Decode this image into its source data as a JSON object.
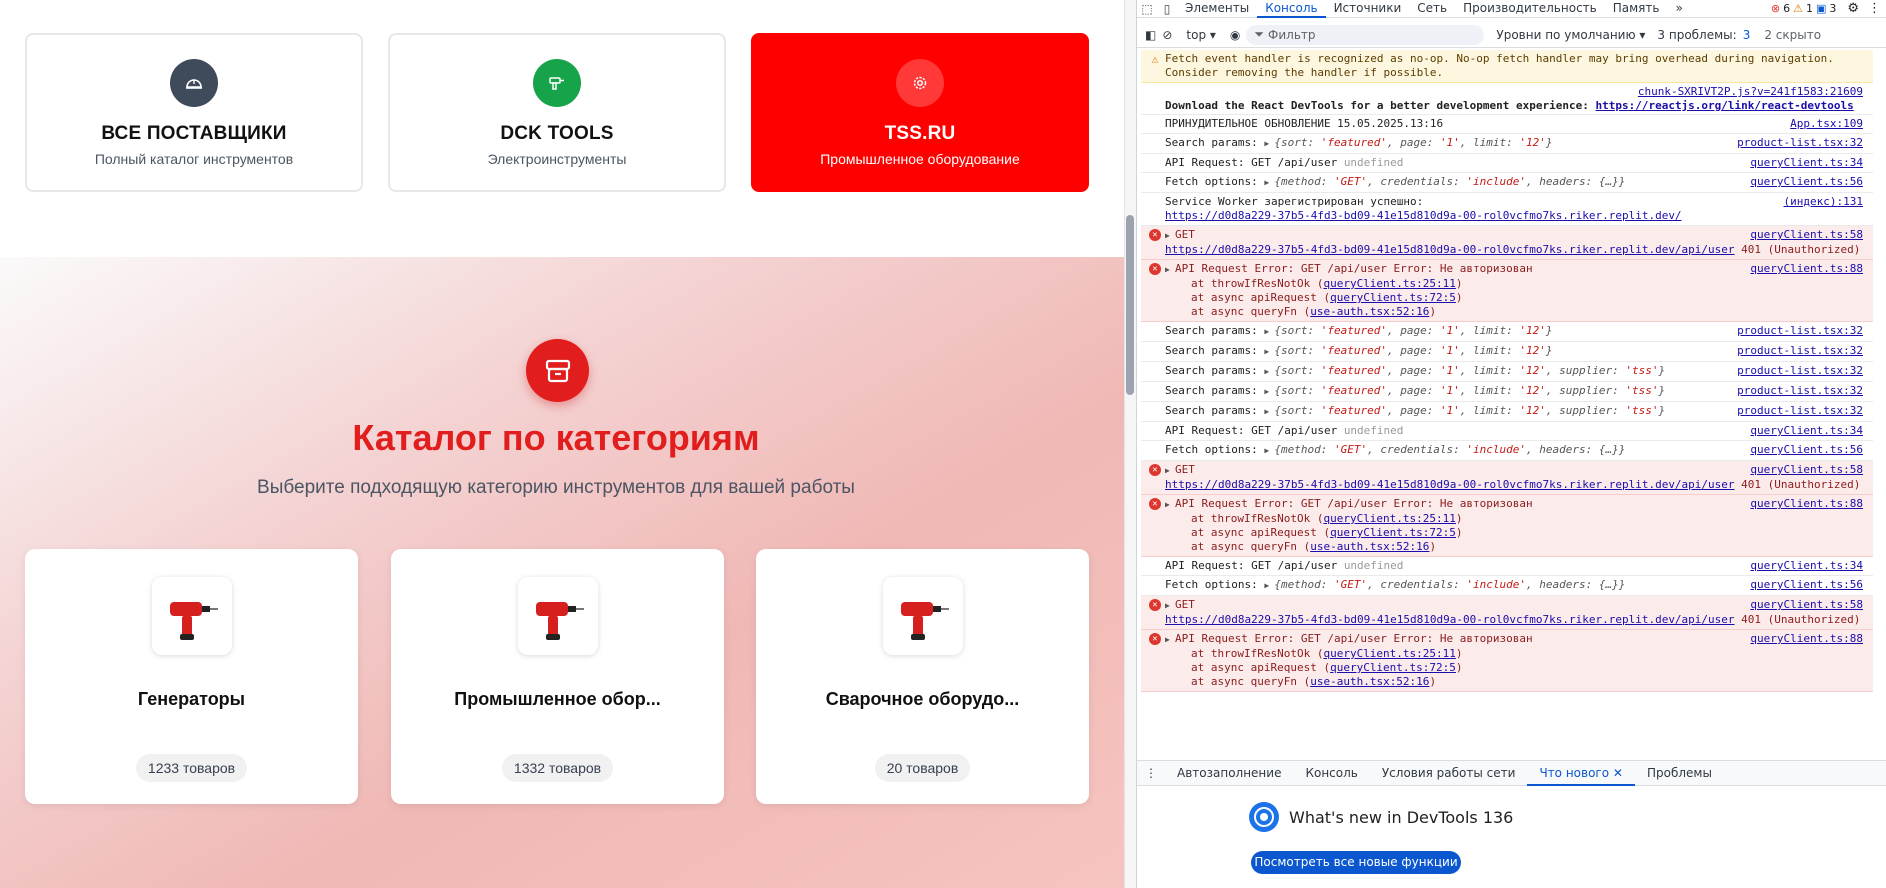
{
  "suppliers": [
    {
      "name": "ВСЕ ПОСТАВЩИКИ",
      "desc": "Полный каталог инструментов",
      "icon": "helmet-icon",
      "color": "#3f4a5a"
    },
    {
      "name": "DCK TOOLS",
      "desc": "Электроинструменты",
      "icon": "drill-icon",
      "color": "#16a34a"
    },
    {
      "name": "TSS.RU",
      "desc": "Промышленное оборудование",
      "icon": "gear-icon",
      "color": "#ff0000"
    }
  ],
  "catalog": {
    "title": "Каталог по категориям",
    "subtitle": "Выберите подходящую категорию инструментов для вашей работы",
    "icon": "box-icon",
    "categories": [
      {
        "name": "Генераторы",
        "count": "1233 товаров",
        "image": "drill-image"
      },
      {
        "name": "Промышленное обор...",
        "count": "1332 товаров",
        "image": "drill-image"
      },
      {
        "name": "Сварочное оборудо...",
        "count": "20 товаров",
        "image": "drill-image"
      }
    ]
  },
  "devtools": {
    "tabs": [
      "Элементы",
      "Консоль",
      "Источники",
      "Сеть",
      "Производительность",
      "Память"
    ],
    "more": "»",
    "badges": {
      "errors": "6",
      "warnings": "1",
      "info": "3"
    },
    "toolbar": {
      "context": "top ▾",
      "filter_placeholder": "Фильтр",
      "levels": "Уровни по умолчанию ▾",
      "issues": "3 проблемы:",
      "issues_count": "3",
      "hidden": "2 скрыто"
    },
    "console": {
      "warning_line1": "Fetch event handler is recognized as no-op. No-op fetch handler may bring overhead during navigation.",
      "warning_line2": "Consider removing the handler if possible.",
      "chunk_src": "chunk-SXRIVT2P.js?v=241f1583:21609",
      "react_msg": "Download the React DevTools for a better development experience: ",
      "react_link": "https://reactjs.org/link/react-devtools",
      "forced_update": "ПРИНУДИТЕЛЬНОЕ ОБНОВЛЕНИЕ 15.05.2025.13:16",
      "app_src": "App.tsx:109",
      "search_label": "Search params:",
      "product_src": "product-list.tsx:32",
      "api_label": "API Request: GET /api/user ",
      "undefined": "undefined",
      "query34": "queryClient.ts:34",
      "fetch_label": "Fetch options:",
      "query56": "queryClient.ts:56",
      "sw_msg": "Service Worker зарегистрирован успешно:",
      "sw_src": "(индекс):131",
      "sw_url": "https://d0d8a229-37b5-4fd3-bd09-41e15d810d9a-00-rol0vcfmo7ks.riker.replit.dev/",
      "get_label": "GET",
      "get_url": "https://d0d8a229-37b5-4fd3-bd09-41e15d810d9a-00-rol0vcfmo7ks.riker.replit.dev/api/user",
      "get_status": " 401 (Unauthorized)",
      "query58": "queryClient.ts:58",
      "err_msg": "API Request Error: GET /api/user Error: Не авторизован",
      "query88": "queryClient.ts:88",
      "stack1_pre": "at throwIfResNotOk (",
      "stack1_link": "queryClient.ts:25:11",
      "stack2_pre": "at async apiRequest (",
      "stack2_link": "queryClient.ts:72:5",
      "stack3_pre": "at async queryFn (",
      "stack3_link": "use-auth.tsx:52:16",
      "close_paren": ")",
      "obj_sort_key": "sort: ",
      "obj_sort_val": "'featured'",
      "obj_page_key": ", page: ",
      "obj_page_val": "'1'",
      "obj_limit_key": ", limit: ",
      "obj_limit_val": "'12'",
      "obj_supplier_key": ", supplier: ",
      "obj_supplier_val": "'tss'",
      "obj_method_key": "method: ",
      "obj_method_val": "'GET'",
      "obj_cred_key": ", credentials: ",
      "obj_cred_val": "'include'",
      "obj_headers": ", headers: {…}"
    },
    "drawer_tabs": [
      "Автозаполнение",
      "Консоль",
      "Условия работы сети",
      "Что нового",
      "Проблемы"
    ],
    "whatsnew_title": "What's new in DevTools 136",
    "whatsnew_button": "Посмотреть все новые функции"
  }
}
